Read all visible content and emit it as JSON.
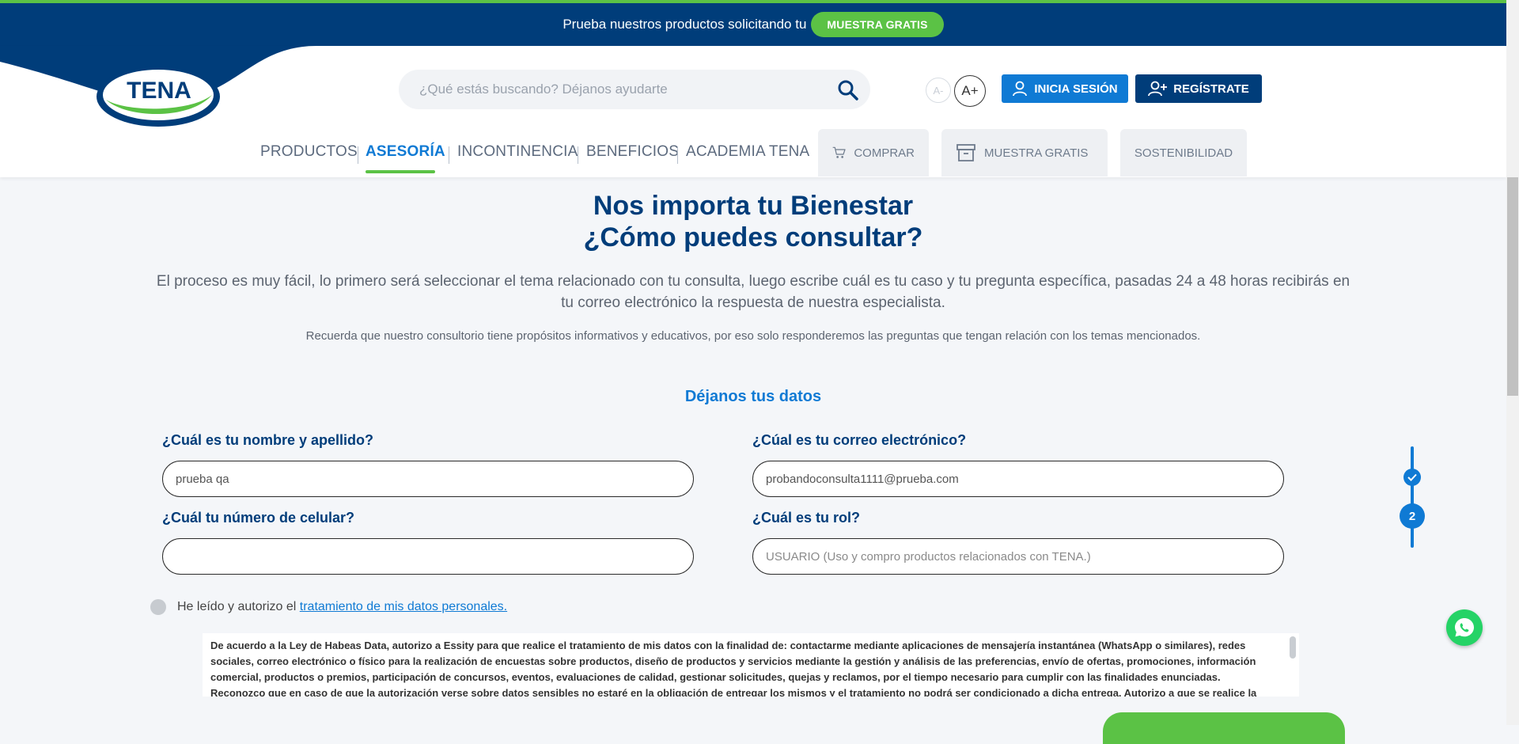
{
  "promo": {
    "text": "Prueba nuestros productos solicitando tu",
    "button": "MUESTRA GRATIS"
  },
  "logo": {
    "text": "TENA"
  },
  "search": {
    "placeholder": "¿Qué estás buscando? Déjanos ayudarte"
  },
  "font_size": {
    "decrease": "A-",
    "increase": "A+"
  },
  "auth": {
    "login": "INICIA SESIÓN",
    "register": "REGÍSTRATE"
  },
  "nav": {
    "items": [
      {
        "label": "PRODUCTOS"
      },
      {
        "label": "ASESORÍA"
      },
      {
        "label": "INCONTINENCIA"
      },
      {
        "label": "BENEFICIOS"
      },
      {
        "label": "ACADEMIA TENA"
      }
    ],
    "boxes": [
      {
        "label": "COMPRAR",
        "icon": "cart-icon"
      },
      {
        "label": "MUESTRA GRATIS",
        "icon": "box-icon"
      },
      {
        "label": "SOSTENIBILIDAD"
      }
    ]
  },
  "page": {
    "title_line1": "Nos importa tu Bienestar",
    "title_line2": "¿Cómo puedes consultar?",
    "intro": "El proceso es muy fácil, lo primero será seleccionar el tema relacionado con tu consulta, luego escribe cuál es tu caso y tu pregunta específica, pasadas 24 a 48 horas recibirás en tu correo electrónico la respuesta de nuestra especialista.",
    "note": "Recuerda que nuestro consultorio tiene propósitos informativos y educativos, por eso solo responderemos las preguntas que tengan relación con los temas mencionados."
  },
  "form": {
    "section_title": "Déjanos tus datos",
    "name_label": "¿Cuál es tu nombre y apellido?",
    "name_value": "prueba qa",
    "email_label": "¿Cúal es tu correo electrónico?",
    "email_value": "probandoconsulta1111@prueba.com",
    "phone_label": "¿Cuál tu número de celular?",
    "phone_value": "",
    "role_label": "¿Cuál es tu rol?",
    "role_value": "USUARIO (Uso y compro productos relacionados con TENA.)",
    "consent_text": "He leído y autorizo el",
    "consent_link": "tratamiento de mis datos personales.",
    "legal_text": "De acuerdo a la Ley de Habeas Data, autorizo a Essity para que realice el tratamiento de mis datos con la finalidad de: contactarme mediante aplicaciones de mensajería instantánea (WhatsApp o similares), redes sociales, correo electrónico o físico para la realización de encuestas sobre productos, diseño de productos y servicios mediante la gestión y análisis de las preferencias, envío de ofertas, promociones, información comercial, productos o premios, participación de concursos, eventos, evaluaciones de calidad, gestionar solicitudes, quejas y reclamos, por el tiempo necesario para cumplir con las finalidades enunciadas. Reconozco que en caso de que la autorización verse sobre datos sensibles no estaré en la obligación de entregar los mismos y el tratamiento no podrá ser condicionado a dicha entrega. Autorizo a que se realice la"
  },
  "steps": {
    "current": "2"
  },
  "colors": {
    "brand_blue": "#003d7a",
    "accent_blue": "#0f7ad4",
    "accent_green": "#5bc245"
  }
}
